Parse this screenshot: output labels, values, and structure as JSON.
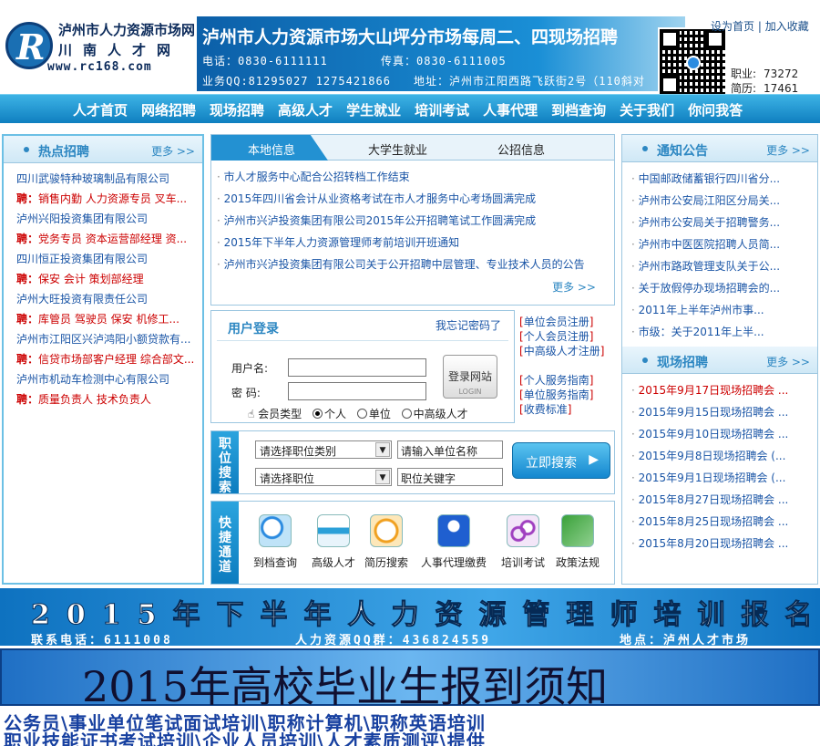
{
  "header": {
    "logo_line1": "泸州市人力资源市场网",
    "logo_line2": "川南人才网",
    "logo_url": "www.rc168.com",
    "banner_title": "泸州市人力资源市场大山坪分市场每周二、四现场招聘",
    "banner_phone": "电话：0830-6111111",
    "banner_fax": "传真：0830-6111005",
    "banner_qq": "业务QQ:81295027  1275421866",
    "banner_address": "地址：泸州市江阳西路飞跃街2号（110斜对",
    "link_home": "设为首页",
    "link_fav": "加入收藏",
    "stat1_label": "职业:",
    "stat1_value": "73272",
    "stat2_label": "简历:",
    "stat2_value": "17461"
  },
  "nav": [
    "人才首页",
    "网络招聘",
    "现场招聘",
    "高级人才",
    "学生就业",
    "培训考试",
    "人事代理",
    "到档查询",
    "关于我们",
    "你问我答"
  ],
  "hot": {
    "title": "热点招聘",
    "more": "更多 >>",
    "items": [
      {
        "company": "四川武骏特种玻璃制品有限公司",
        "jobs": "销售内勤  人力资源专员  叉车..."
      },
      {
        "company": "泸州兴阳投资集团有限公司",
        "jobs": "党务专员  资本运营部经理  资..."
      },
      {
        "company": "四川恒正投资集团有限公司",
        "jobs": "保安  会计  策划部经理"
      },
      {
        "company": "泸州大旺投资有限责任公司",
        "jobs": "库管员  驾驶员  保安  机修工..."
      },
      {
        "company": "泸州市江阳区兴泸鸿阳小额贷款有...",
        "jobs": "信贷市场部客户经理  综合部文..."
      },
      {
        "company": "泸州市机动车检测中心有限公司",
        "jobs": "质量负责人  技术负责人"
      }
    ],
    "job_prefix": "聘："
  },
  "news": {
    "tabs": [
      "本地信息",
      "大学生就业",
      "公招信息"
    ],
    "items": [
      "市人才服务中心配合公招转档工作结束",
      "2015年四川省会计从业资格考试在市人才服务中心考场圆满完成",
      "泸州市兴泸投资集团有限公司2015年公开招聘笔试工作圆满完成",
      "2015年下半年人力资源管理师考前培训开班通知",
      "泸州市兴泸投资集团有限公司关于公开招聘中层管理、专业技术人员的公告"
    ],
    "more": "更多 >>"
  },
  "login": {
    "title": "用户登录",
    "forgot": "我忘记密码了",
    "username_label": "用户名:",
    "password_label": "密  码:",
    "button": "登录网站",
    "button_sub": "LOGIN",
    "type_label": "会员类型",
    "types": [
      "个人",
      "单位",
      "中高级人才"
    ]
  },
  "register_links": [
    "单位会员注册",
    "个人会员注册",
    "中高级人才注册",
    "个人服务指南",
    "单位服务指南",
    "收费标准"
  ],
  "search": {
    "side_title": "职位搜索",
    "category_select": "请选择职位类别",
    "position_select": "请选择职位",
    "company_placeholder": "请输入单位名称",
    "keyword_placeholder": "职位关键字",
    "button": "立即搜索"
  },
  "quick": {
    "side_title": "快捷通道",
    "items": [
      {
        "label": "到档查询",
        "icon": "magnifier-icon"
      },
      {
        "label": "高级人才",
        "icon": "card-icon"
      },
      {
        "label": "简历搜索",
        "icon": "clock-icon"
      },
      {
        "label": "人事代理缴费",
        "icon": "user-icon"
      },
      {
        "label": "培训考试",
        "icon": "link-icon"
      },
      {
        "label": "政策法规",
        "icon": "map-icon"
      }
    ]
  },
  "notice": {
    "title": "通知公告",
    "more": "更多 >>",
    "items": [
      "中国邮政储蓄银行四川省分...",
      "泸州市公安局江阳区分局关...",
      "泸州市公安局关于招聘警务...",
      "泸州市中医医院招聘人员简...",
      "泸州市路政管理支队关于公...",
      "关于放假停办现场招聘会的...",
      "2011年上半年泸州市事...",
      "市级：关于2011年上半..."
    ]
  },
  "fair": {
    "title": "现场招聘",
    "more": "更多 >>",
    "items": [
      "2015年9月17日现场招聘会 ...",
      "2015年9月15日现场招聘会 ...",
      "2015年9月10日现场招聘会 ...",
      "2015年9月8日现场招聘会 (...",
      "2015年9月1日现场招聘会 (...",
      "2015年8月27日现场招聘会 ...",
      "2015年8月25日现场招聘会 ...",
      "2015年8月20日现场招聘会 ..."
    ]
  },
  "banners": {
    "b1_title": "2015年下半年人力资源管理师培训报名",
    "b1_phone": "联系电话：6111008",
    "b1_qq": "人力资源QQ群：436824559",
    "b1_addr": "地点：泸州人才市场",
    "b2_title": "2015年高校毕业生报到须知",
    "b3_line1": "公务员\\事业单位笔试面试培训\\职称计算机\\职称英语培训",
    "b3_line2": "职业技能证书考试培训\\企业人员培训\\人才素质测评\\提供"
  },
  "colors": {
    "accent": "#2391d2",
    "nav": "#0f7fc0",
    "red": "#cc0000",
    "link": "#1a55a6"
  }
}
